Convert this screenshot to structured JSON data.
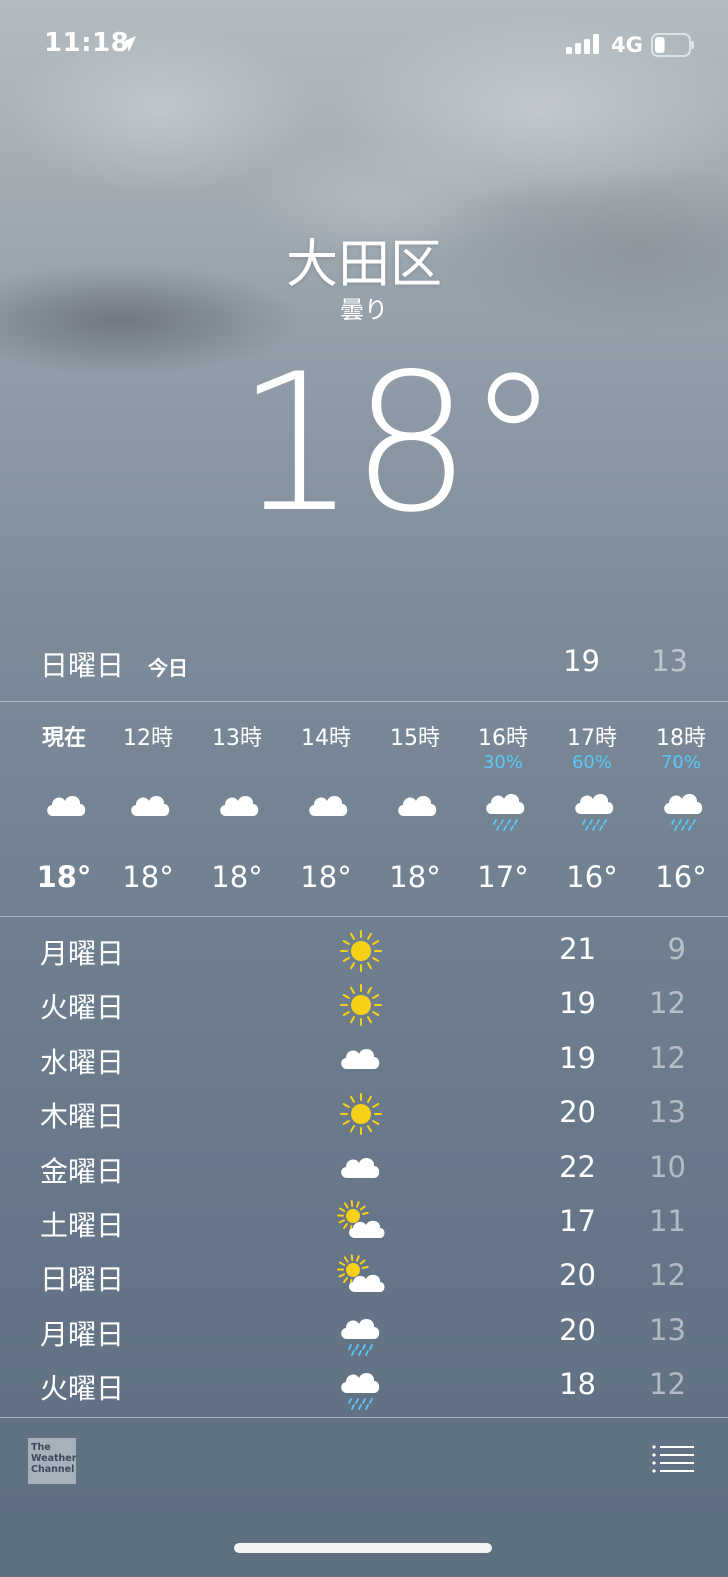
{
  "status_bar": {
    "time": "11:18",
    "network": "4G",
    "battery_level": 0.3
  },
  "header": {
    "city": "大田区",
    "condition": "曇り",
    "temperature": "18°"
  },
  "today": {
    "day": "日曜日",
    "label": "今日",
    "high": "19",
    "low": "13"
  },
  "hourly": [
    {
      "time": "現在",
      "pop": "",
      "icon": "cloud-icon",
      "temp": "18°"
    },
    {
      "time": "12時",
      "pop": "",
      "icon": "cloud-icon",
      "temp": "18°"
    },
    {
      "time": "13時",
      "pop": "",
      "icon": "cloud-icon",
      "temp": "18°"
    },
    {
      "time": "14時",
      "pop": "",
      "icon": "cloud-icon",
      "temp": "18°"
    },
    {
      "time": "15時",
      "pop": "",
      "icon": "cloud-icon",
      "temp": "18°"
    },
    {
      "time": "16時",
      "pop": "30%",
      "icon": "rain-cloud-icon",
      "temp": "17°"
    },
    {
      "time": "17時",
      "pop": "60%",
      "icon": "rain-cloud-icon",
      "temp": "16°"
    },
    {
      "time": "18時",
      "pop": "70%",
      "icon": "rain-cloud-icon",
      "temp": "16°"
    }
  ],
  "daily": [
    {
      "day": "月曜日",
      "icon": "sun-icon",
      "high": "21",
      "low": "9"
    },
    {
      "day": "火曜日",
      "icon": "sun-icon",
      "high": "19",
      "low": "12"
    },
    {
      "day": "水曜日",
      "icon": "cloud-icon",
      "high": "19",
      "low": "12"
    },
    {
      "day": "木曜日",
      "icon": "sun-icon",
      "high": "20",
      "low": "13"
    },
    {
      "day": "金曜日",
      "icon": "cloud-icon",
      "high": "22",
      "low": "10"
    },
    {
      "day": "土曜日",
      "icon": "partly-cloudy-icon",
      "high": "17",
      "low": "11"
    },
    {
      "day": "日曜日",
      "icon": "partly-cloudy-icon",
      "high": "20",
      "low": "12"
    },
    {
      "day": "月曜日",
      "icon": "rain-cloud-icon",
      "high": "20",
      "low": "13"
    },
    {
      "day": "火曜日",
      "icon": "rain-cloud-icon",
      "high": "18",
      "low": "12"
    }
  ],
  "footer": {
    "logo_text": "The Weather Channel"
  },
  "colors": {
    "sun": "#f7d117",
    "rain": "#5ac8fa",
    "cloud": "#ffffff"
  }
}
